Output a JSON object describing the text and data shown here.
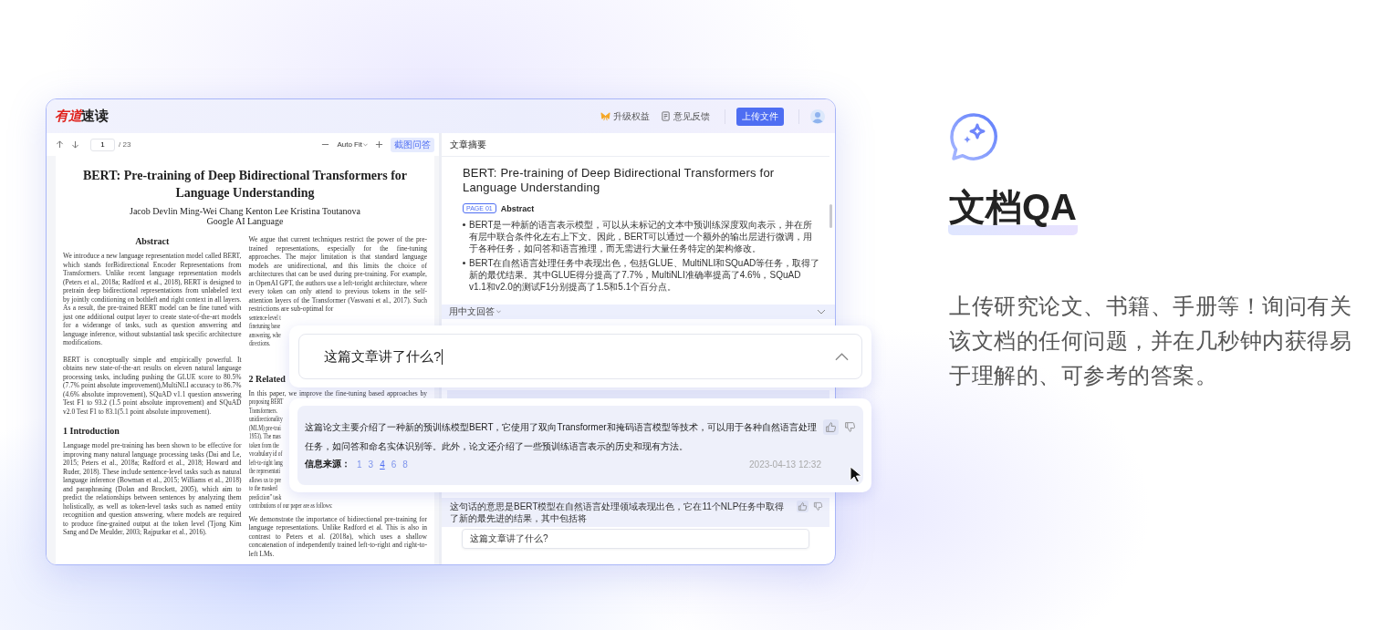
{
  "logo": {
    "brand": "有道",
    "product": "速读"
  },
  "header_actions": [
    {
      "label": "升级权益",
      "kind": "upgrade"
    },
    {
      "label": "意见反馈",
      "kind": "feedback"
    }
  ],
  "upload_button": "上传文件",
  "viewer_toolbar": {
    "page": "1",
    "page_count": "/ 23",
    "zoom": "Auto Fit",
    "screenshot_button": "截图问答"
  },
  "paper": {
    "title": "BERT: Pre-training of Deep Bidirectional Transformers for Language Understanding",
    "authors": "Jacob Devlin Ming-Wei Chang Kenton Lee Kristina Toutanova",
    "affiliation": "Google AI Language",
    "left_column": [
      {
        "kind": "section_title",
        "text": "Abstract"
      },
      {
        "kind": "paragraph",
        "text": "We introduce a new language representation model called BERT, which stands forBidirectional Encoder Representations from Transformers. Unlike recent language representation models (Peters et al., 2018a; Radford et al., 2018), BERT is designed to pretrain deep bidirectional representations from unlabeled text by jointly conditioning on bothleft and right context in all layers. As a result, the pre-trained BERT model can be fine tuned with just one additional output layer to create state-of-the-art models for a widerange of tasks, such as question answering and language inference, without substantial task specific architecture modifications."
      },
      {
        "kind": "paragraph",
        "text": "BERT is conceptually simple and empirically powerful. It obtains new state-of-the-art results on eleven natural language processing tasks, including pushing the GLUE score to 80.5% (7.7% point absolute improvement),MultiNLI accuracy to 86.7% (4.6% absolute improvement), SQuAD v1.1 question answering Test F1 to 93.2 (1.5 point absolute improvement) and SQuAD v2.0 Test F1 to 83.1(5.1 point absolute improvement)."
      },
      {
        "kind": "heading",
        "text": "1 Introduction"
      },
      {
        "kind": "paragraph",
        "text": "Language model pre-training has been shown to be effective for improving many natural language processing tasks (Dai and Le, 2015; Peters et al., 2018a; Radford et al., 2018; Howard and Ruder, 2018). These include sentence-level tasks such as natural language inference (Bowman et al., 2015; Williams et al., 2018) and paraphrasing (Dolan and Brockett, 2005), which aim to predict the relationships between sentences by analyzing them holistically, as well as token-level tasks such as named entity recognition and question answering, where models are required to produce fine-grained output at the token level (Tjong Kim Sang and De Meulder, 2003; Rajpurkar et al., 2016)."
      }
    ],
    "right_column": [
      {
        "kind": "paragraph",
        "text": "We argue that current techniques restrict the power of the pre-trained representations, especially for the fine-tuning approaches. The major limitation is that standard language models are unidirectional, and this limits the choice of architectures that can be used during pre-training. For example, in OpenAI GPT, the authors use a left-toright architecture, where every token can only attend to previous tokens in the self-attention layers of the Transformer (Vaswani et al., 2017). Such restrictions are sub-optimal for"
      },
      {
        "kind": "fragment",
        "text": "sentence-level t"
      },
      {
        "kind": "fragment",
        "text": "finetuning base"
      },
      {
        "kind": "fragment",
        "text": "answering, whe"
      },
      {
        "kind": "fragment",
        "text": "directions."
      },
      {
        "kind": "heading",
        "text": "2 Related"
      },
      {
        "kind": "line",
        "text": "In this paper, we improve the fine-tuning based approaches by"
      },
      {
        "kind": "fragment",
        "text": "proposing BERT"
      },
      {
        "kind": "fragment",
        "text": "Transformers."
      },
      {
        "kind": "fragment",
        "text": "unidirectionality"
      },
      {
        "kind": "fragment",
        "text": "(MLM) pre-trai"
      },
      {
        "kind": "fragment",
        "text": "1953). The mas"
      },
      {
        "kind": "fragment",
        "text": "token from the"
      },
      {
        "kind": "fragment",
        "text": "vocabulary id of"
      },
      {
        "kind": "fragment",
        "text": "left-to-right lang"
      },
      {
        "kind": "fragment",
        "text": "the representati"
      },
      {
        "kind": "fragment",
        "text": "allows us to pre"
      },
      {
        "kind": "fragment",
        "text": "to the masked"
      },
      {
        "kind": "fragment",
        "text": "prediction” task"
      },
      {
        "kind": "fragment",
        "text": "contributions of our paper are as follows:"
      },
      {
        "kind": "paragraph",
        "text": "We demonstrate the importance of bidirectional pre-training for language representations. Unlike Radford et al. This is also in contrast to Peters et al. (2018a), which uses a shallow concatenation of independently trained left-to-right and right-to-left LMs."
      }
    ]
  },
  "summary": {
    "heading": "文章摘要",
    "title": "BERT: Pre-training of Deep Bidirectional Transformers for Language Understanding",
    "section_tag": "PAGE 01",
    "section_title": "Abstract",
    "bullets": [
      "BERT是一种新的语言表示模型，可以从未标记的文本中预训练深度双向表示，并在所有层中联合条件化左右上下文。因此，BERT可以通过一个额外的输出层进行微调，用于各种任务，如问答和语言推理，而无需进行大量任务特定的架构修改。",
      "BERT在自然语言处理任务中表现出色，包括GLUE、MultiNLI和SQuAD等任务，取得了新的最优结果。其中GLUE得分提高了7.7%，MultiNLI准确率提高了4.6%，SQuAD v1.1和v2.0的测试F1分别提高了1.5和5.1个百分点。"
    ]
  },
  "answer_language": "用中文回答",
  "history_answer": {
    "text": "这句话的意思是BERT模型在自然语言处理领域表现出色，它在11个NLP任务中取得了新的最先进的结果，其中包括将",
    "liked": true
  },
  "chat_input": {
    "value": "这篇文章讲了什么?"
  },
  "question_card": {
    "value": "这篇文章讲了什么?"
  },
  "answer_card": {
    "text": "这篇论文主要介绍了一种新的预训练模型BERT，它使用了双向Transformer和掩码语言模型等技术，可以用于各种自然语言处理任务，如问答和命名实体识别等。此外，论文还介绍了一些预训练语言表示的历史和现有方法。",
    "sources_label": "信息来源：",
    "sources": [
      {
        "label": "1",
        "selected": false
      },
      {
        "label": "3",
        "selected": false
      },
      {
        "label": "4",
        "selected": true
      },
      {
        "label": "6",
        "selected": false
      },
      {
        "label": "8",
        "selected": false
      }
    ],
    "time": "2023-04-13 12:32",
    "liked": true
  },
  "feature": {
    "title": "文档QA",
    "description": "上传研究论文、书籍、手册等！询问有关该文档的任何问题，并在几秒钟内获得易于理解的、可参考的答案。"
  }
}
